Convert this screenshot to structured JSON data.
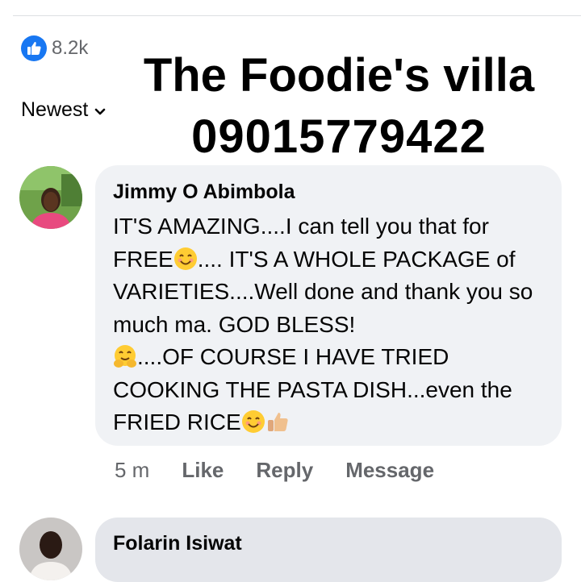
{
  "reactions": {
    "count": "8.2k",
    "icon": "thumbs-up-icon",
    "color": "#1877f2"
  },
  "sort": {
    "label": "Newest",
    "icon": "chevron-down-icon"
  },
  "watermark": {
    "line1": "The Foodie's villa",
    "line2": "09015779422"
  },
  "comments": [
    {
      "author": "Jimmy O Abimbola",
      "text": {
        "p1": "IT'S AMAZING....I can tell you that for FREE",
        "p2": ".... IT'S A WHOLE PACKAGE of VARIETIES....Well done and thank you so much ma. GOD BLESS!",
        "p3": "....OF COURSE I HAVE TRIED COOKING THE PASTA DISH...even the FRIED RICE"
      },
      "emojis": [
        "smiling-face-icon",
        "hugging-face-icon",
        "smiling-face-icon",
        "thumbs-up-icon"
      ],
      "time": "5 m",
      "actions": {
        "like": "Like",
        "reply": "Reply",
        "message": "Message"
      }
    },
    {
      "author": "Folarin Isiwat"
    }
  ]
}
